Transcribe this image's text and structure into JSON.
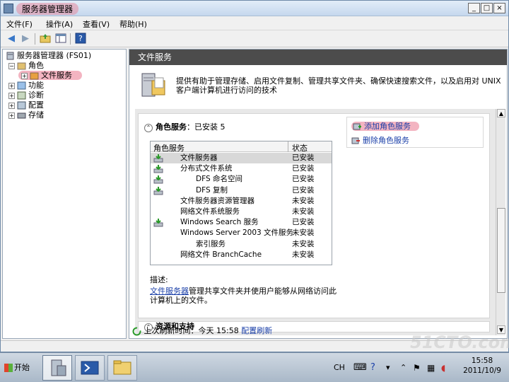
{
  "window": {
    "title": "服务器管理器",
    "buttons": [
      "_",
      "□",
      "×"
    ]
  },
  "menubar": [
    "文件(F)",
    "操作(A)",
    "查看(V)",
    "帮助(H)"
  ],
  "toolbar": {
    "icons": [
      "back-arrow-icon",
      "forward-arrow-icon",
      "up-folder-icon",
      "show-hide-tree-icon",
      "help-icon"
    ]
  },
  "tree": {
    "root": "服务器管理器 (FS01)",
    "roles": "角色",
    "file_services": "文件服务",
    "features": "功能",
    "diagnostics": "诊断",
    "configuration": "配置",
    "storage": "存储"
  },
  "content": {
    "header": "文件服务",
    "description": "提供有助于管理存储、启用文件复制、管理共享文件夹、确保快速搜索文件，以及启用对 UNIX 客户端计算机进行访问的技术",
    "role_services": {
      "title": "角色服务",
      "installed": "已安装 5",
      "add_link": "添加角色服务",
      "remove_link": "删除角色服务",
      "col_name": "角色服务",
      "col_status": "状态",
      "rows": [
        {
          "name": "文件服务器",
          "status": "已安装",
          "indent": 0,
          "installed": true
        },
        {
          "name": "分布式文件系统",
          "status": "已安装",
          "indent": 0,
          "installed": true
        },
        {
          "name": "DFS 命名空间",
          "status": "已安装",
          "indent": 1,
          "installed": true
        },
        {
          "name": "DFS 复制",
          "status": "已安装",
          "indent": 1,
          "installed": true
        },
        {
          "name": "文件服务器资源管理器",
          "status": "未安装",
          "indent": 0,
          "installed": false
        },
        {
          "name": "网络文件系统服务",
          "status": "未安装",
          "indent": 0,
          "installed": false
        },
        {
          "name": "Windows Search 服务",
          "status": "已安装",
          "indent": 0,
          "installed": true
        },
        {
          "name": "Windows Server 2003 文件服务",
          "status": "未安装",
          "indent": 0,
          "installed": false
        },
        {
          "name": "索引服务",
          "status": "未安装",
          "indent": 1,
          "installed": false
        },
        {
          "name": "网络文件 BranchCache",
          "status": "未安装",
          "indent": 0,
          "installed": false
        }
      ],
      "desc_label": "描述:",
      "desc_link": "文件服务器",
      "desc_text": "管理共享文件夹并使用户能够从网络访问此计算机上的文件。"
    },
    "resources_title": "资源和支持",
    "refresh": {
      "label": "上次刷新时间：今天 15:58",
      "link": "配置刷新"
    }
  },
  "taskbar": {
    "start": "开始",
    "lang": "CH",
    "time": "15:58",
    "date": "2011/10/9"
  },
  "watermark": "51CTO.com"
}
